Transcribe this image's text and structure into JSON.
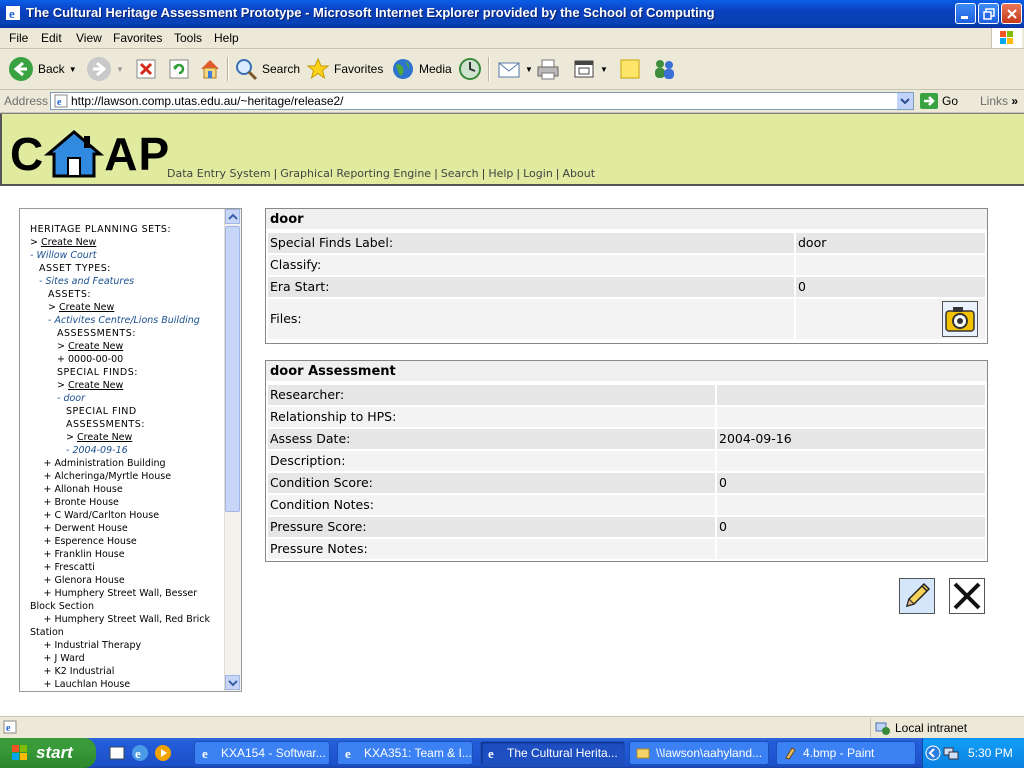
{
  "window": {
    "title": "The Cultural Heritage Assessment Prototype - Microsoft Internet Explorer provided by the School of Computing"
  },
  "menu": [
    "File",
    "Edit",
    "View",
    "Favorites",
    "Tools",
    "Help"
  ],
  "toolbar": {
    "back": "Back",
    "search": "Search",
    "favorites": "Favorites",
    "media": "Media"
  },
  "address": {
    "label": "Address",
    "url": "http://lawson.comp.utas.edu.au/~heritage/release2/",
    "go": "Go",
    "links": "Links"
  },
  "site": {
    "logo_left": "C",
    "logo_right": "AP",
    "nav": [
      "Data Entry System",
      "Graphical Reporting Engine",
      "Search",
      "Help",
      "Login",
      "About"
    ]
  },
  "tree": [
    {
      "text": "HERITAGE PLANNING SETS:",
      "indent": 0,
      "style": "cap"
    },
    {
      "prefix": "> ",
      "text": "Create New",
      "indent": 0,
      "style": "u"
    },
    {
      "prefix": "- ",
      "text": "Willow Court",
      "indent": 0,
      "style": "lk"
    },
    {
      "text": "ASSET TYPES:",
      "indent": 1,
      "style": "cap"
    },
    {
      "prefix": "- ",
      "text": "Sites and Features",
      "indent": 1,
      "style": "lk"
    },
    {
      "text": "ASSETS:",
      "indent": 2,
      "style": "cap"
    },
    {
      "prefix": "> ",
      "text": "Create New",
      "indent": 2,
      "style": "u"
    },
    {
      "prefix": "- ",
      "text": "Activites Centre/Lions Building",
      "indent": 2,
      "style": "lk"
    },
    {
      "text": "ASSESSMENTS:",
      "indent": 3,
      "style": "cap"
    },
    {
      "prefix": "> ",
      "text": "Create New",
      "indent": 3,
      "style": "u"
    },
    {
      "prefix": "+ ",
      "text": "0000-00-00",
      "indent": 3,
      "style": ""
    },
    {
      "text": "SPECIAL FINDS:",
      "indent": 3,
      "style": "cap"
    },
    {
      "prefix": "> ",
      "text": "Create New",
      "indent": 3,
      "style": "u"
    },
    {
      "prefix": "- ",
      "text": "door",
      "indent": 3,
      "style": "lk"
    },
    {
      "text": "SPECIAL FIND",
      "indent": 4,
      "style": "cap"
    },
    {
      "text": "ASSESSMENTS:",
      "indent": 4,
      "style": "cap"
    },
    {
      "prefix": "> ",
      "text": "Create New",
      "indent": 4,
      "style": "u"
    },
    {
      "prefix": "- ",
      "text": "2004-09-16",
      "indent": 4,
      "style": "lk"
    },
    {
      "prefix": "+ ",
      "text": "Administration Building",
      "indent": 1.5,
      "style": ""
    },
    {
      "prefix": "+ ",
      "text": "Alcheringa/Myrtle House",
      "indent": 1.5,
      "style": ""
    },
    {
      "prefix": "+ ",
      "text": "Allonah House",
      "indent": 1.5,
      "style": ""
    },
    {
      "prefix": "+ ",
      "text": "Bronte House",
      "indent": 1.5,
      "style": ""
    },
    {
      "prefix": "+ ",
      "text": "C Ward/Carlton House",
      "indent": 1.5,
      "style": ""
    },
    {
      "prefix": "+ ",
      "text": "Derwent House",
      "indent": 1.5,
      "style": ""
    },
    {
      "prefix": "+ ",
      "text": "Esperence House",
      "indent": 1.5,
      "style": ""
    },
    {
      "prefix": "+ ",
      "text": "Franklin House",
      "indent": 1.5,
      "style": ""
    },
    {
      "prefix": "+ ",
      "text": "Frescatti",
      "indent": 1.5,
      "style": ""
    },
    {
      "prefix": "+ ",
      "text": "Glenora House",
      "indent": 1.5,
      "style": ""
    },
    {
      "prefix": "+ ",
      "text": "Humphery Street Wall, Besser",
      "indent": 1.5,
      "style": ""
    },
    {
      "text": "Block Section",
      "indent": 0,
      "style": ""
    },
    {
      "prefix": "+ ",
      "text": "Humphery Street Wall, Red Brick",
      "indent": 1.5,
      "style": ""
    },
    {
      "text": "Station",
      "indent": 0,
      "style": ""
    },
    {
      "prefix": "+ ",
      "text": "Industrial Therapy",
      "indent": 1.5,
      "style": ""
    },
    {
      "prefix": "+ ",
      "text": "J Ward",
      "indent": 1.5,
      "style": ""
    },
    {
      "prefix": "+ ",
      "text": "K2 Industrial",
      "indent": 1.5,
      "style": ""
    },
    {
      "prefix": "+ ",
      "text": "Lauchlan House",
      "indent": 1.5,
      "style": ""
    }
  ],
  "find": {
    "title": "door",
    "rows": [
      {
        "label": "Special Finds Label:",
        "value": "door"
      },
      {
        "label": "Classify:",
        "value": ""
      },
      {
        "label": "Era Start:",
        "value": "0"
      },
      {
        "label": "Files:",
        "value": ""
      }
    ]
  },
  "assessment": {
    "title": "door Assessment",
    "rows": [
      {
        "label": "Researcher:",
        "value": ""
      },
      {
        "label": "Relationship to HPS:",
        "value": ""
      },
      {
        "label": "Assess Date:",
        "value": "2004-09-16"
      },
      {
        "label": "Description:",
        "value": ""
      },
      {
        "label": "Condition Score:",
        "value": "0"
      },
      {
        "label": "Condition Notes:",
        "value": ""
      },
      {
        "label": "Pressure Score:",
        "value": "0"
      },
      {
        "label": "Pressure Notes:",
        "value": ""
      }
    ]
  },
  "status": {
    "zone": "Local intranet"
  },
  "taskbar": {
    "start": "start",
    "tasks": [
      "KXA154 - Softwar...",
      "KXA351: Team & I...",
      "The Cultural Herita...",
      "\\\\lawson\\aahyland...",
      "4.bmp - Paint"
    ],
    "clock": "5:30 PM"
  }
}
